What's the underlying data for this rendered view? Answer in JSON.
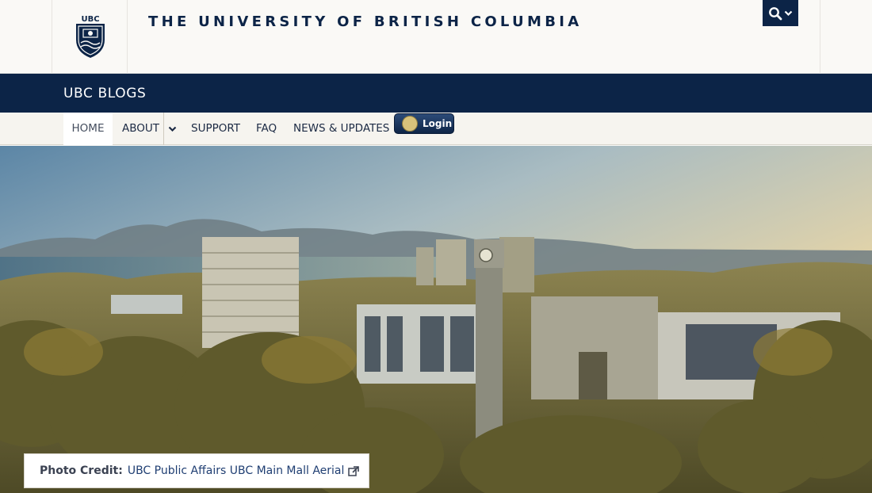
{
  "header": {
    "crest_text": "UBC",
    "wordmark": "THE UNIVERSITY OF BRITISH COLUMBIA",
    "search_icon": "search-icon",
    "brand_color": "#0c2447"
  },
  "site": {
    "title": "UBC BLOGS"
  },
  "nav": {
    "home": "HOME",
    "about": "ABOUT",
    "support": "SUPPORT",
    "faq": "FAQ",
    "news": "NEWS & UPDATES",
    "login": "Login"
  },
  "hero": {
    "credit_label": "Photo Credit:",
    "credit_text": "UBC Public Affairs UBC Main Mall Aerial",
    "external_icon": "external-link-icon"
  }
}
